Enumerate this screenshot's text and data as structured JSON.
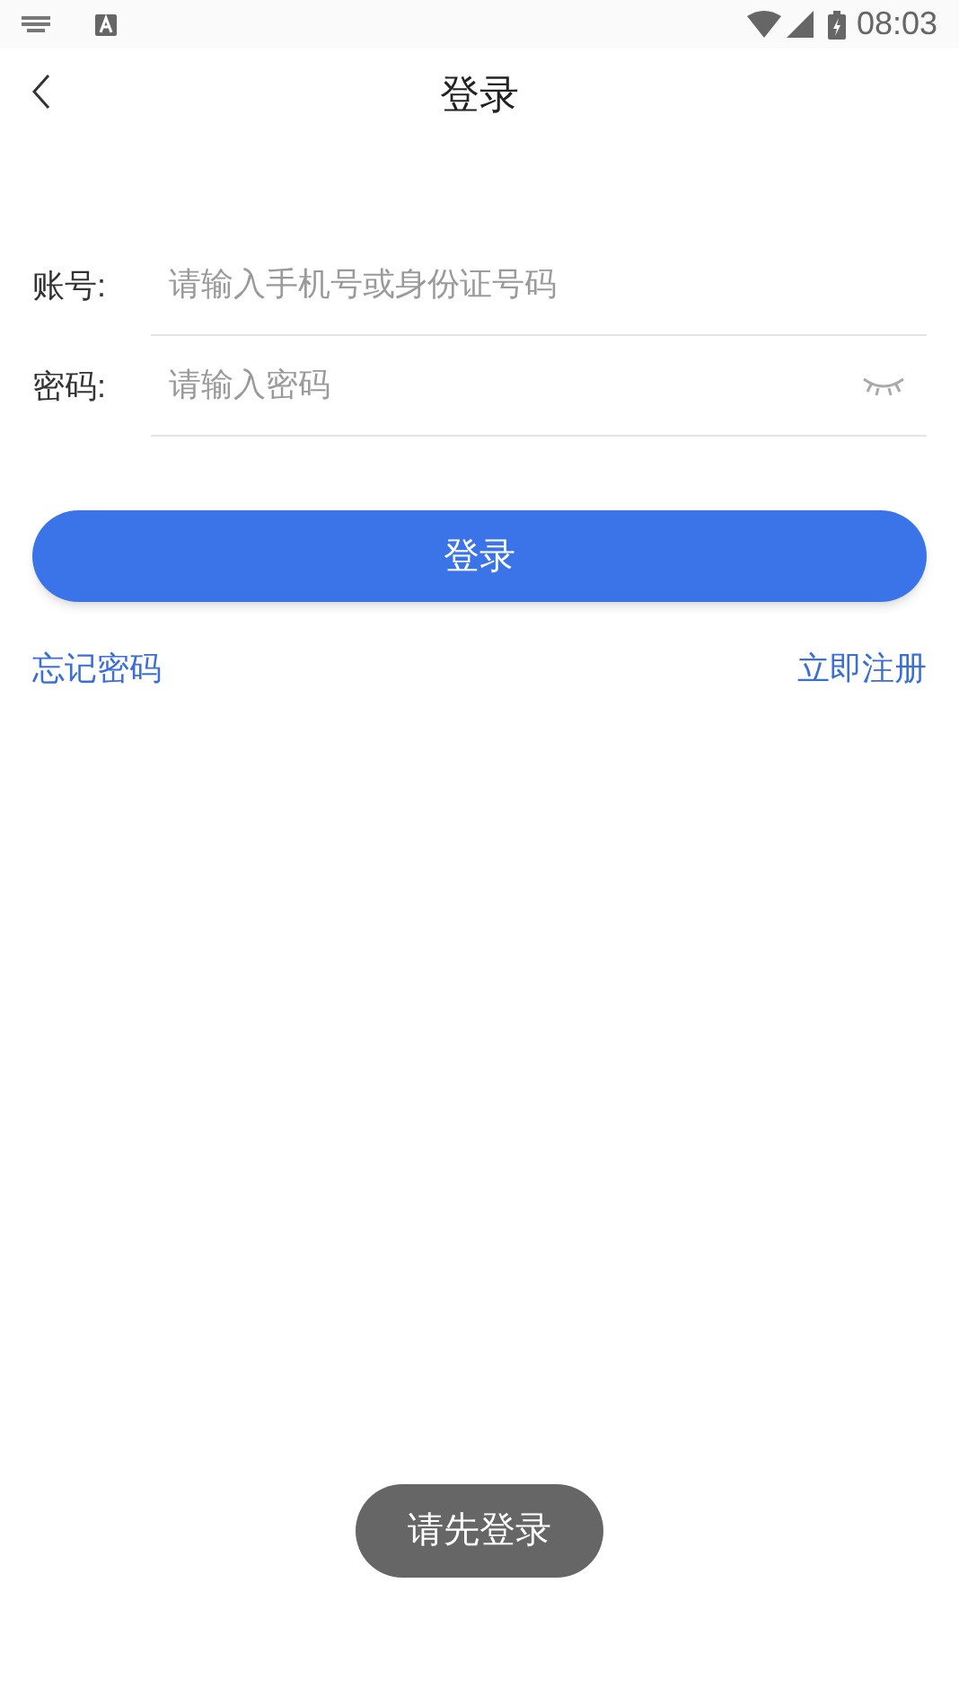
{
  "status_bar": {
    "time": "08:03"
  },
  "header": {
    "title": "登录"
  },
  "fields": [
    {
      "kind": "text",
      "label": "账号:",
      "placeholder": "请输入手机号或身份证号码"
    },
    {
      "kind": "password",
      "label": "密码:",
      "placeholder": "请输入密码"
    }
  ],
  "login_button": {
    "label": "登录"
  },
  "links": [
    {
      "label": "忘记密码"
    },
    {
      "label": "立即注册"
    }
  ],
  "toast": {
    "text": "请先登录"
  }
}
